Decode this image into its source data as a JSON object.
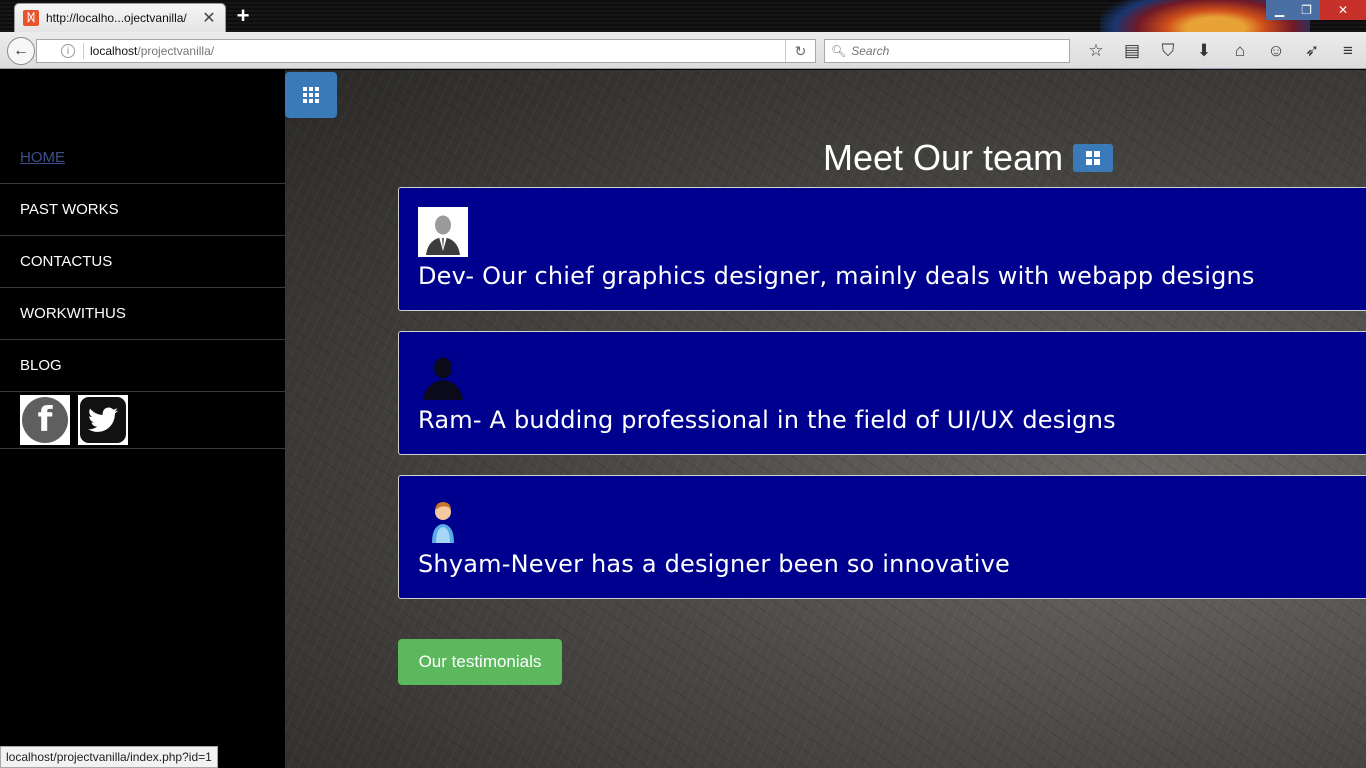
{
  "browser": {
    "tab_title": "http://localho...ojectvanilla/",
    "url_host": "localhost",
    "url_path": "/projectvanilla/",
    "search_placeholder": "Search",
    "status_url": "localhost/projectvanilla/index.php?id=1"
  },
  "sidebar": {
    "items": [
      {
        "label": "HOME",
        "active": true
      },
      {
        "label": "PAST WORKS"
      },
      {
        "label": "CONTACTUS"
      },
      {
        "label": "WORKWITHUS"
      },
      {
        "label": "BLOG"
      }
    ],
    "social": [
      {
        "name": "facebook-icon",
        "glyph": "f"
      },
      {
        "name": "twitter-icon"
      }
    ]
  },
  "main": {
    "title": "Meet Our team",
    "team": [
      {
        "desc": "Dev- Our chief graphics designer, mainly deals with webapp designs",
        "avatar": "businessman-avatar-icon"
      },
      {
        "desc": "Ram- A budding professional in the field of UI/UX designs",
        "avatar": "silhouette-avatar-icon"
      },
      {
        "desc": "Shyam-Never has a designer been so innovative",
        "avatar": "cartoon-avatar-icon"
      }
    ],
    "testimonials_label": "Our testimonials"
  },
  "colors": {
    "card_bg": "#00008e",
    "accent_blue": "#3a7ab8",
    "success_green": "#5cb85c",
    "sidebar_bg": "#000000"
  }
}
